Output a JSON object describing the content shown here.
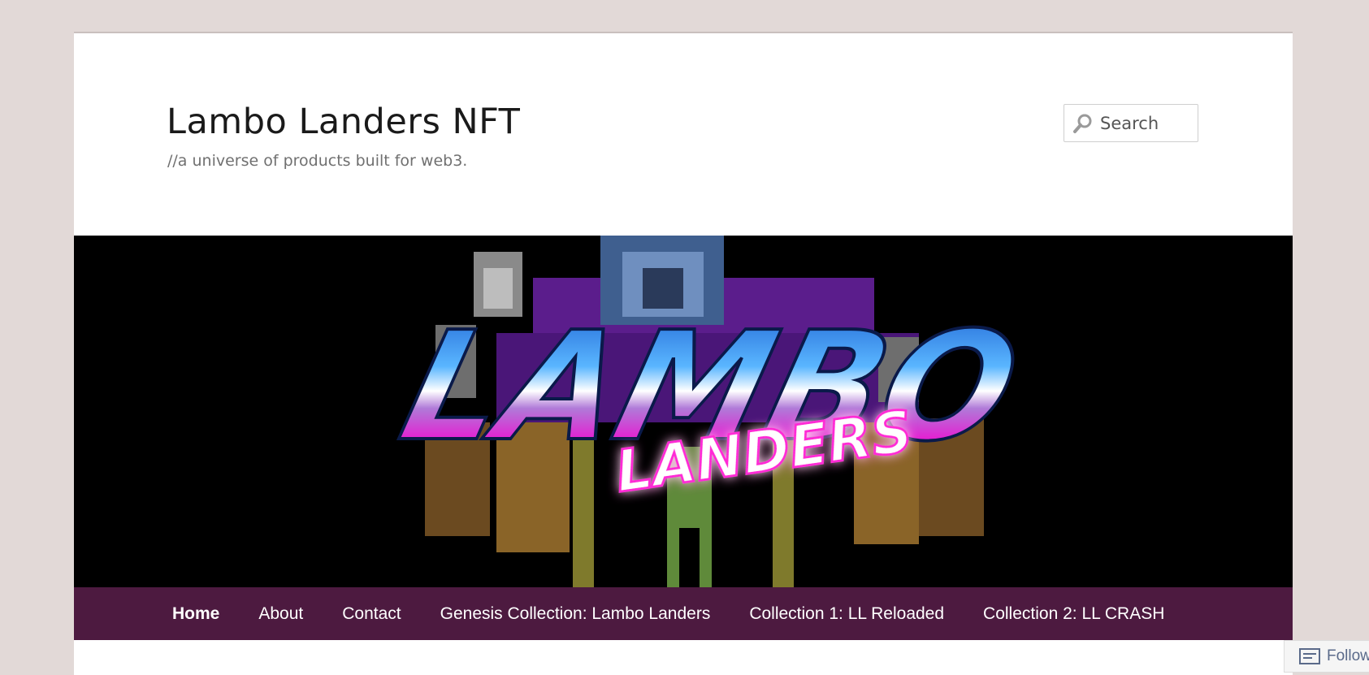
{
  "site": {
    "title": "Lambo Landers NFT",
    "tagline": "//a universe of products built for web3."
  },
  "search": {
    "placeholder": "Search"
  },
  "banner": {
    "logo_main": "LAMBO",
    "logo_sub": "LANDERS"
  },
  "nav": {
    "items": [
      {
        "label": "Home"
      },
      {
        "label": "About"
      },
      {
        "label": "Contact"
      },
      {
        "label": "Genesis Collection: Lambo Landers"
      },
      {
        "label": "Collection 1: LL Reloaded"
      },
      {
        "label": "Collection 2: LL CRASH"
      }
    ]
  },
  "follow": {
    "label": "Follow"
  },
  "colors": {
    "background": "#e2d9d7",
    "nav_bg": "#4d1a40",
    "accent_magenta": "#ff2bd6",
    "accent_blue": "#1e90ff"
  }
}
